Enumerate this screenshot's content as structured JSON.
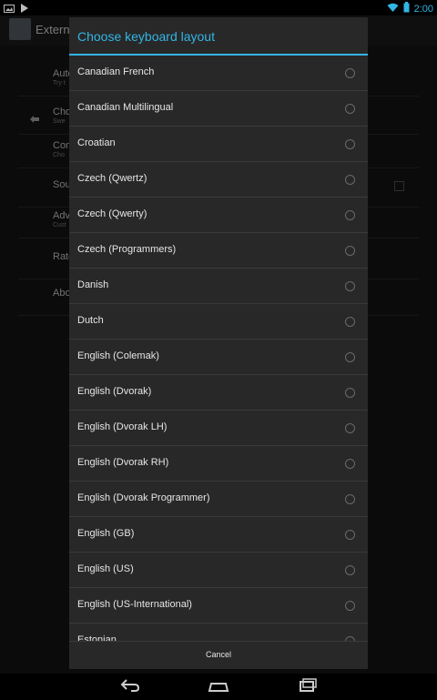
{
  "status": {
    "time": "2:00"
  },
  "app": {
    "title": "Externa",
    "rows": [
      {
        "title": "Auto",
        "sub": "Try t"
      },
      {
        "title": "Cho",
        "sub": "Swe"
      },
      {
        "title": "Con",
        "sub": "Cho"
      },
      {
        "title": "Sou",
        "sub": ""
      },
      {
        "title": "Adv",
        "sub": "Cust"
      },
      {
        "title": "Rate",
        "sub": ""
      },
      {
        "title": "Abo",
        "sub": ""
      }
    ]
  },
  "dialog": {
    "title": "Choose keyboard layout",
    "items": [
      "Canadian French",
      "Canadian Multilingual",
      "Croatian",
      "Czech (Qwertz)",
      "Czech (Qwerty)",
      "Czech (Programmers)",
      "Danish",
      "Dutch",
      "English (Colemak)",
      "English (Dvorak)",
      "English (Dvorak LH)",
      "English (Dvorak RH)",
      "English (Dvorak Programmer)",
      "English (GB)",
      "English (US)",
      "English (US-International)",
      "Estonian"
    ],
    "cancel_label": "Cancel"
  },
  "colors": {
    "accent": "#33b5e5",
    "dialog_bg": "#282828",
    "divider": "#3a3a3a"
  },
  "icons": {
    "status_left": [
      "photo-icon",
      "play-store-icon"
    ],
    "status_right": [
      "wifi-icon",
      "battery-icon"
    ],
    "nav": [
      "back-icon",
      "home-icon",
      "recents-icon"
    ]
  }
}
